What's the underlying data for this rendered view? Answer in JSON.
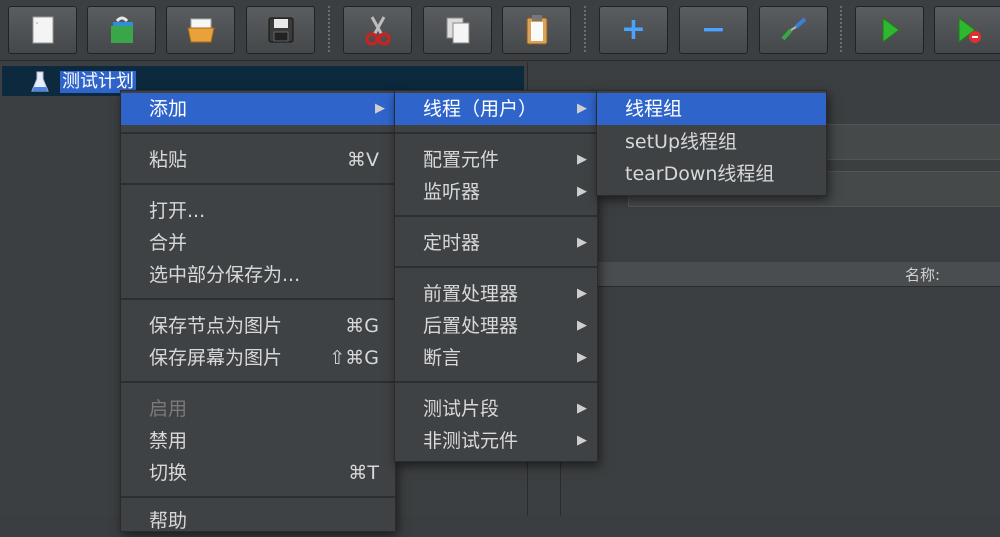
{
  "toolbar": {
    "buttons": [
      {
        "icon": "new-icon"
      },
      {
        "icon": "templates-icon"
      },
      {
        "icon": "open-icon"
      },
      {
        "icon": "save-icon"
      },
      {
        "icon": "cut-icon"
      },
      {
        "icon": "copy-icon"
      },
      {
        "icon": "paste-icon"
      },
      {
        "icon": "expand-icon",
        "glyph": "+"
      },
      {
        "icon": "collapse-icon",
        "glyph": "−"
      },
      {
        "icon": "toggle-icon"
      },
      {
        "icon": "start-icon"
      },
      {
        "icon": "start-no-pause-icon"
      }
    ]
  },
  "tree": {
    "root_label": "测试计划"
  },
  "right_pane": {
    "name_column": "名称:"
  },
  "context_menu": {
    "items": [
      {
        "label": "添加",
        "submenu": true,
        "highlighted": true
      },
      {
        "label": "粘贴",
        "shortcut": "⌘V"
      },
      {
        "label": "打开..."
      },
      {
        "label": "合并"
      },
      {
        "label": "选中部分保存为..."
      },
      {
        "label": "保存节点为图片",
        "shortcut": "⌘G"
      },
      {
        "label": "保存屏幕为图片",
        "shortcut": "⇧⌘G"
      },
      {
        "label": "启用",
        "disabled": true
      },
      {
        "label": "禁用"
      },
      {
        "label": "切换",
        "shortcut": "⌘T"
      },
      {
        "label": "帮助"
      }
    ]
  },
  "add_submenu": {
    "items": [
      {
        "label": "线程（用户）",
        "submenu": true,
        "highlighted": true
      },
      {
        "label": "配置元件",
        "submenu": true
      },
      {
        "label": "监听器",
        "submenu": true
      },
      {
        "label": "定时器",
        "submenu": true
      },
      {
        "label": "前置处理器",
        "submenu": true
      },
      {
        "label": "后置处理器",
        "submenu": true
      },
      {
        "label": "断言",
        "submenu": true
      },
      {
        "label": "测试片段",
        "submenu": true
      },
      {
        "label": "非测试元件",
        "submenu": true
      }
    ]
  },
  "threads_submenu": {
    "items": [
      {
        "label": "线程组",
        "highlighted": true
      },
      {
        "label": "setUp线程组"
      },
      {
        "label": "tearDown线程组"
      }
    ]
  },
  "colors": {
    "highlight": "#2f65ca",
    "menu_bg": "#3f4244",
    "menu_text": "#d8d8d8",
    "disabled_text": "#7a7a7a",
    "run_green": "#2fb82f"
  }
}
